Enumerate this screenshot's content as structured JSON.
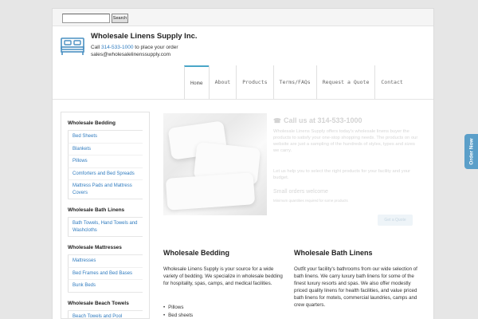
{
  "search": {
    "placeholder": "",
    "button_label": "Search"
  },
  "header": {
    "title": "Wholesale Linens Supply Inc.",
    "call_prefix": "Call ",
    "phone": "314-533-1000",
    "call_suffix": " to place your order",
    "email": "sales@wholesalelinenssupply.com"
  },
  "nav": {
    "items": [
      {
        "label": "Home",
        "active": true
      },
      {
        "label": "About"
      },
      {
        "label": "Products"
      },
      {
        "label": "Terms/FAQs"
      },
      {
        "label": "Request a Quote"
      },
      {
        "label": "Contact"
      }
    ]
  },
  "sidebar": {
    "sections": [
      {
        "heading": "Wholesale Bedding",
        "items": [
          "Bed Sheets",
          "Blankets",
          "Pillows",
          "Comforters and Bed Spreads",
          "Mattress Pads and Mattress Covers"
        ]
      },
      {
        "heading": "Wholesale Bath Linens",
        "items": [
          "Bath Towels, Hand Towels and Washcloths"
        ]
      },
      {
        "heading": "Wholesale Mattresses",
        "items": [
          "Mattresses",
          "Bed Frames and Bed Bases",
          "Bunk Beds"
        ]
      },
      {
        "heading": "Wholesale Beach Towels",
        "items": [
          "Beach Towels and Pool"
        ]
      }
    ]
  },
  "hero": {
    "call_us": "Call us at 314-533-1000",
    "text1": "Wholesale Linens Supply offers today's wholesale linens buyer the products to satisfy your one-stop shopping needs. The products on our website are just a sampling of the hundreds of styles, types and sizes we carry.",
    "text2": "Let us help you to select the right products for your facility and your budget.",
    "small_orders": "Small orders welcome",
    "small_note": "Minimum quantities required for some products",
    "button_label": "Get a Quote"
  },
  "bedding": {
    "title": "Wholesale Bedding",
    "text": "Wholesale Linens Supply is your source for a wide variety of bedding. We specialize in wholesale bedding for hospitality, spas, camps, and medical facilities.",
    "list": [
      "Pillows",
      "Bed sheets"
    ]
  },
  "bath": {
    "title": "Wholesale Bath Linens",
    "text": "Outfit your facility's bathrooms from our wide selection of bath linens. We carry luxury bath linens for some of the finest luxury resorts and spas. We also offer modestly priced quality linens for health facilities, and value priced bath linens for motels, commercial laundries, camps and crew quarters."
  },
  "order_tab": {
    "label": "Order Now"
  },
  "colors": {
    "accent": "#2f7bbf",
    "nav_active": "#4aa6c8",
    "order_tab": "#5b9fc9"
  }
}
